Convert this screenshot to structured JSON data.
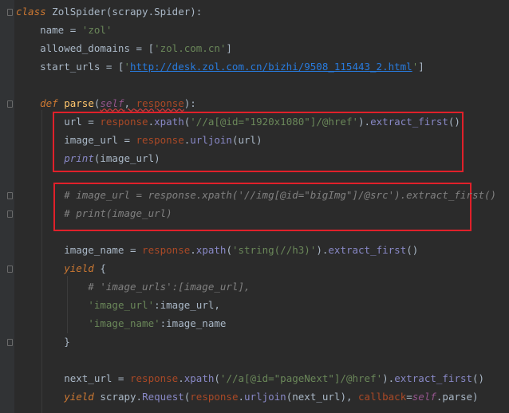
{
  "code": {
    "l1": {
      "kw": "class",
      "rest": " ZolSpider(scrapy.Spider):"
    },
    "l2": {
      "pre": "    name = ",
      "str": "'zol'"
    },
    "l3": {
      "pre": "    allowed_domains = [",
      "str": "'zol.com.cn'",
      "post": "]"
    },
    "l4": {
      "pre": "    start_urls = [",
      "q1": "'",
      "url": "http://desk.zol.com.cn/bizhi/9508_115443_2.html",
      "q2": "'",
      "post": "]"
    },
    "l5": {
      "kw": "    def ",
      "fn": "parse",
      "p1": "(",
      "self": "self",
      "p2": ", ",
      "param": "response",
      "p3": "):"
    },
    "l6": {
      "pre": "        url = ",
      "obj": "response",
      "dot": ".",
      "m": "xpath",
      "p": "(",
      "str": "'//a[@id=\"1920x1080\"]/@href'",
      "post": ").",
      "m2": "extract_first",
      "end": "()"
    },
    "l7": {
      "pre": "        image_url = ",
      "obj": "response",
      "dot": ".",
      "m": "urljoin",
      "post": "(url)"
    },
    "l8": {
      "pre": "        ",
      "bi": "print",
      "post": "(image_url)"
    },
    "l9": {
      "text": "        # image_url = response.xpath('//img[@id=\"bigImg\"]/@src').extract_first()"
    },
    "l10": {
      "text": "        # print(image_url)"
    },
    "l11": {
      "pre": "        image_name = ",
      "obj": "response",
      "dot": ".",
      "m": "xpath",
      "p": "(",
      "str": "'string(//h3)'",
      "post": ").",
      "m2": "extract_first",
      "end": "()"
    },
    "l12": {
      "kw": "        yield",
      "post": " {"
    },
    "l13": {
      "text": "            # 'image_urls':[image_url],"
    },
    "l14": {
      "pre": "            ",
      "str": "'image_url'",
      "post": ":image_url,"
    },
    "l15": {
      "pre": "            ",
      "str": "'image_name'",
      "post": ":image_name"
    },
    "l16": {
      "text": "        }"
    },
    "l17": {
      "pre": "        next_url = ",
      "obj": "response",
      "dot": ".",
      "m": "xpath",
      "p": "(",
      "str": "'//a[@id=\"pageNext\"]/@href'",
      "post": ").",
      "m2": "extract_first",
      "end": "()"
    },
    "l18": {
      "kw": "        yield",
      "a": " scrapy.",
      "m": "Request",
      "b": "(",
      "obj": "response",
      "dot": ".",
      "m2": "urljoin",
      "c": "(next_url), ",
      "param": "callback",
      "eq": "=",
      "self": "self",
      "d": ".parse)"
    }
  },
  "colors": {
    "background": "#2b2b2b",
    "keyword": "#cc7832",
    "string": "#6a8759",
    "comment": "#808080",
    "function": "#ffc66d",
    "self": "#94558d",
    "annotation_box": "#e0202a"
  }
}
